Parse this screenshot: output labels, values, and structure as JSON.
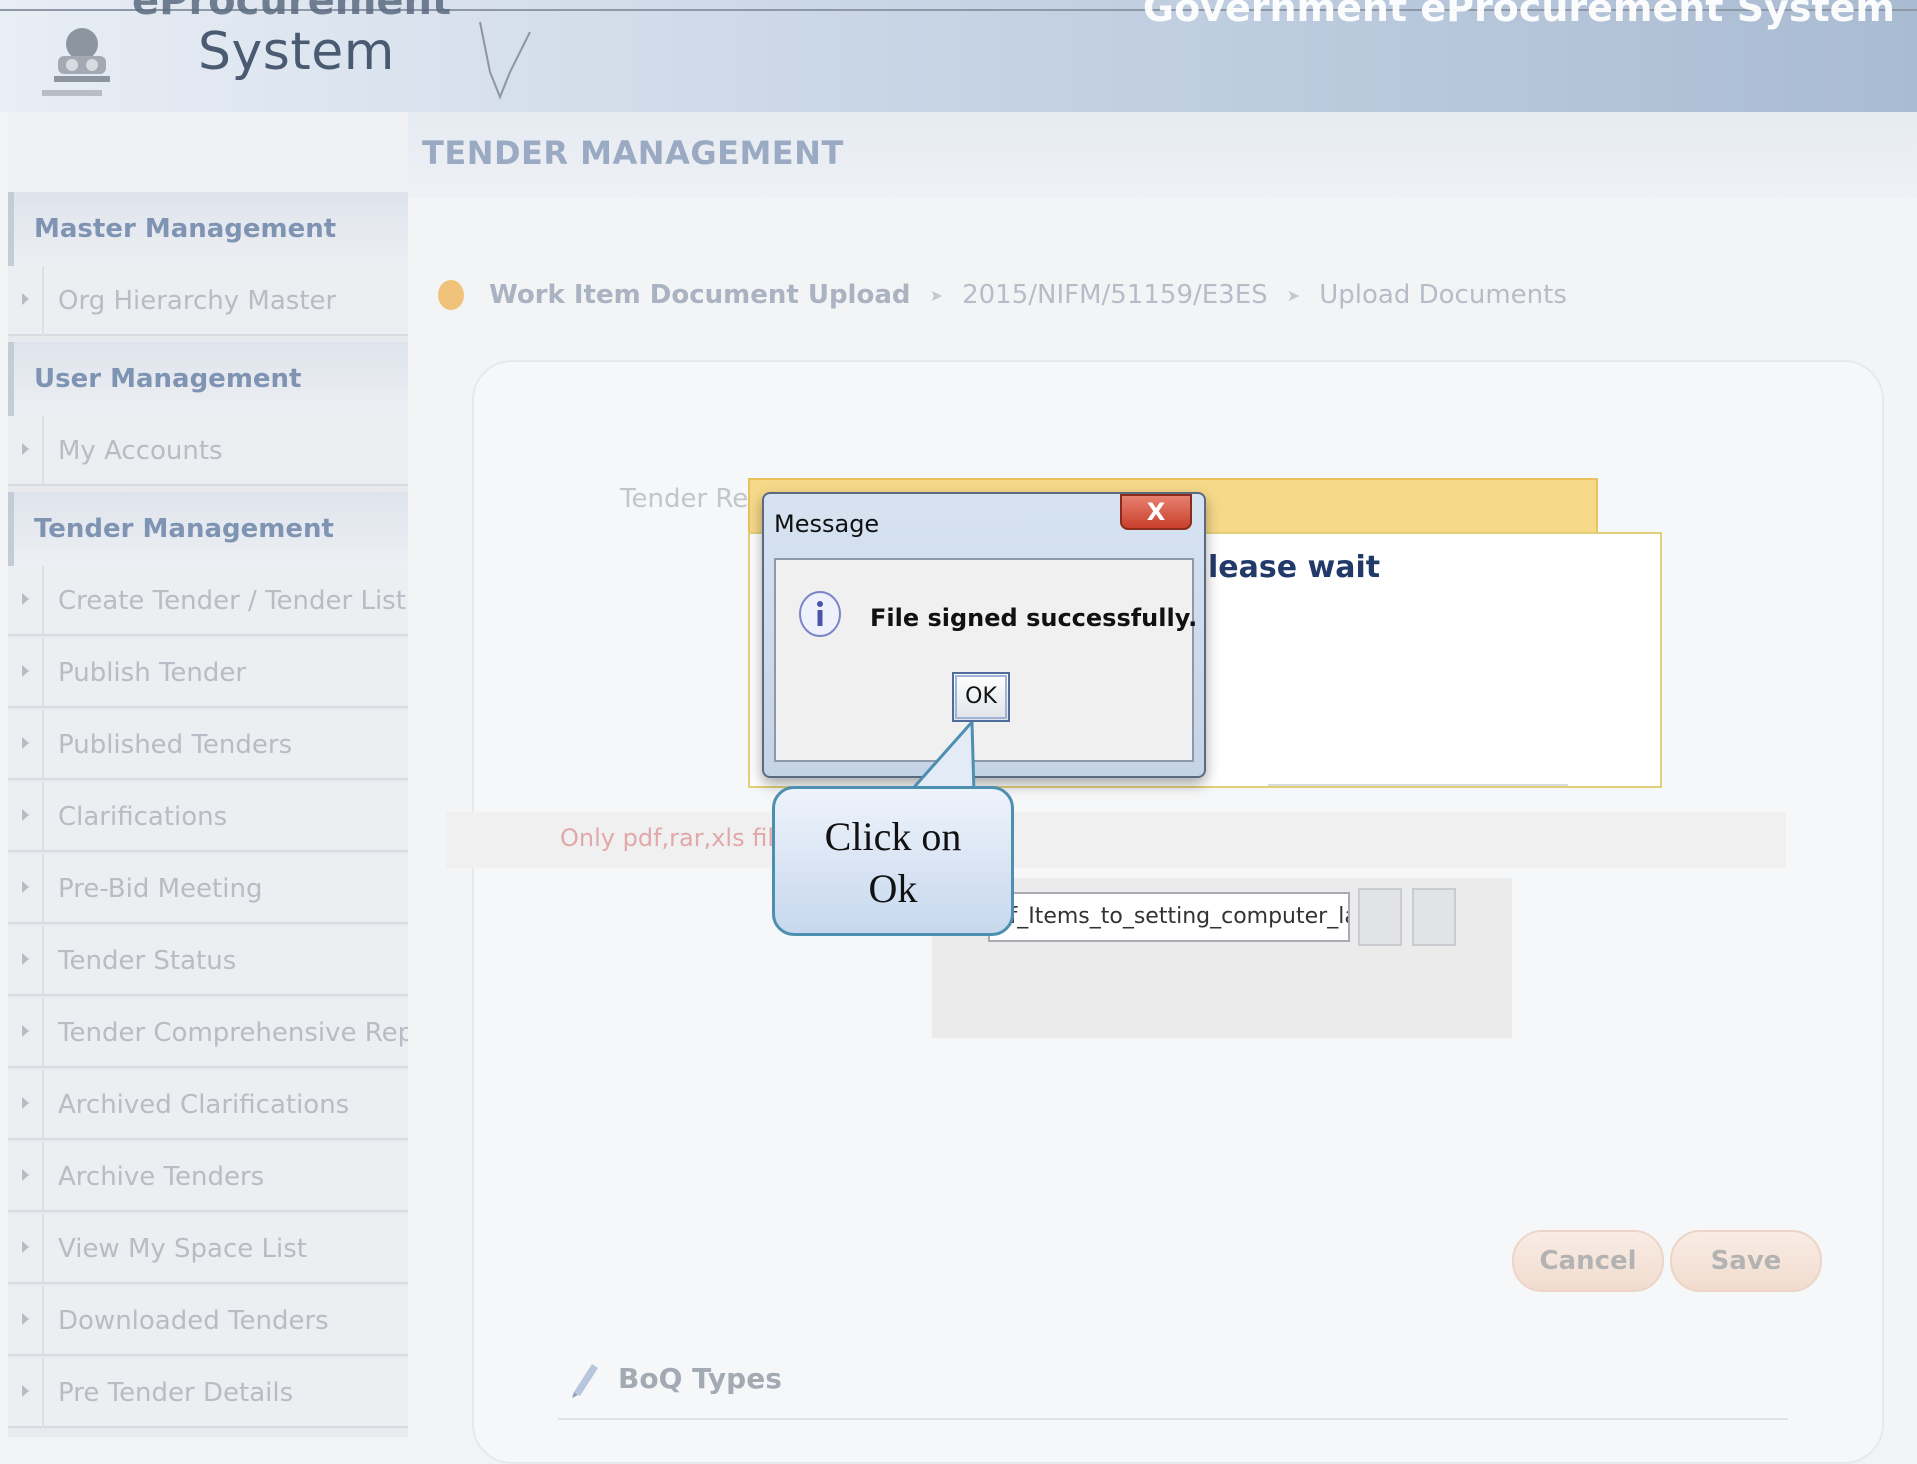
{
  "header": {
    "logo_title_top": "eProcurement",
    "logo_title": "System",
    "right_title": "Government eProcurement System"
  },
  "sidebar": {
    "sections": [
      {
        "title": "Master Management",
        "items": [
          "Org Hierarchy Master"
        ]
      },
      {
        "title": "User Management",
        "items": [
          "My Accounts"
        ]
      },
      {
        "title": "Tender Management",
        "items": [
          "Create Tender / Tender List",
          "Publish Tender",
          "Published Tenders",
          "Clarifications",
          "Pre-Bid Meeting",
          "Tender Status",
          "Tender Comprehensive Report",
          "Archived Clarifications",
          "Archive Tenders",
          "View My Space List",
          "Downloaded Tenders",
          "Pre Tender Details"
        ]
      }
    ]
  },
  "main": {
    "title": "TENDER MANAGEMENT",
    "breadcrumb": [
      "Work Item Document Upload",
      "2015/NIFM/51159/E3ES",
      "Upload Documents"
    ],
    "tender_ref_label": "Tender Ref",
    "please_wait": "lease wait",
    "note": "Only pdf,rar,xls files ar",
    "file_value": "of_Items_to_setting_computer_lab.xls",
    "cancel_label": "Cancel",
    "save_label": "Save",
    "boq_label": "BoQ Types"
  },
  "dialog": {
    "title": "Message",
    "close_label": "X",
    "message": "File signed successfully.",
    "ok_label": "OK"
  },
  "callout": {
    "line1": "Click on",
    "line2": "Ok"
  }
}
